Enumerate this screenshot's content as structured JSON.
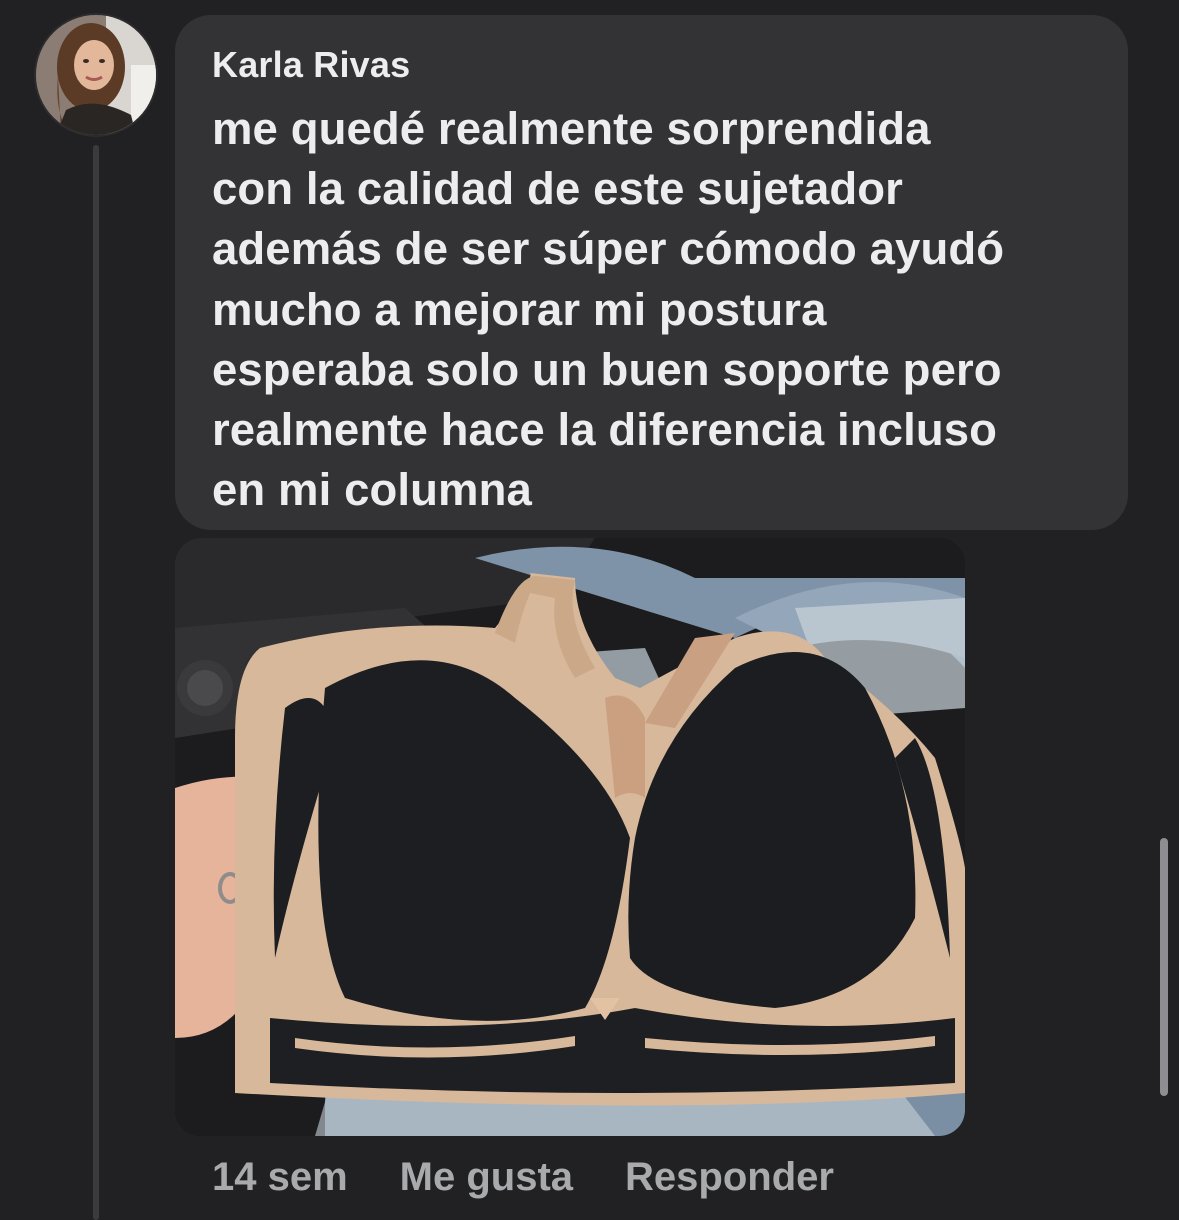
{
  "comment": {
    "author": "Karla Rivas",
    "text": "me quedé realmente sorprendida\ncon la calidad de este sujetador\nademás de ser súper cómodo ayudó\nmucho a mejorar mi postura\nesperaba solo un buen soporte pero\nrealmente hace la diferencia incluso\nen mi columna",
    "avatar_icon": "profile-photo",
    "attachment_icon": "photo-bra"
  },
  "actions": {
    "time": "14 sem",
    "like_label": "Me gusta",
    "reply_label": "Responder"
  },
  "colors": {
    "background": "#212123",
    "bubble": "#333335",
    "text": "#ededef",
    "muted": "#a9aaad"
  }
}
